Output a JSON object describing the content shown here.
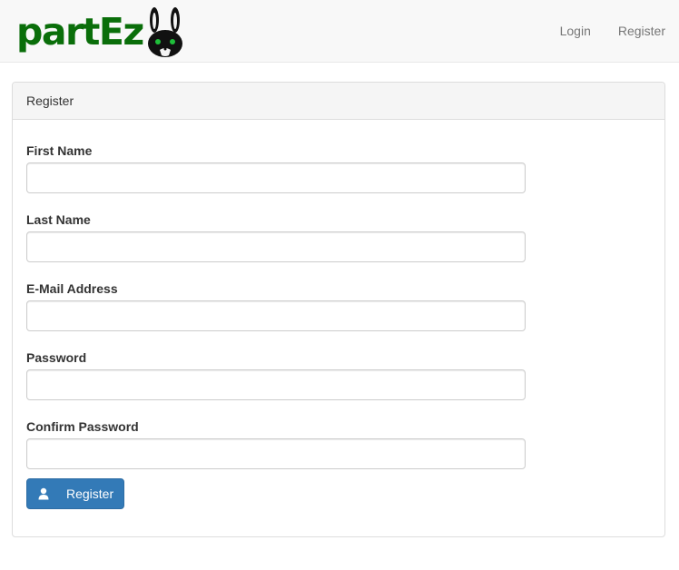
{
  "navbar": {
    "brand": "partEz",
    "logo_icon": "rabbit-logo-icon",
    "links": [
      {
        "label": "Login"
      },
      {
        "label": "Register"
      }
    ]
  },
  "panel": {
    "heading": "Register"
  },
  "form": {
    "fields": [
      {
        "label": "First Name",
        "value": "",
        "placeholder": ""
      },
      {
        "label": "Last Name",
        "value": "",
        "placeholder": ""
      },
      {
        "label": "E-Mail Address",
        "value": "",
        "placeholder": ""
      },
      {
        "label": "Password",
        "value": "",
        "placeholder": ""
      },
      {
        "label": "Confirm Password",
        "value": "",
        "placeholder": ""
      }
    ],
    "submit": {
      "label": "Register",
      "icon": "user-icon"
    }
  },
  "colors": {
    "brand": "#0a6e0a",
    "primary": "#337ab7",
    "navbar_bg": "#f8f8f8",
    "panel_heading_bg": "#f5f5f5"
  }
}
